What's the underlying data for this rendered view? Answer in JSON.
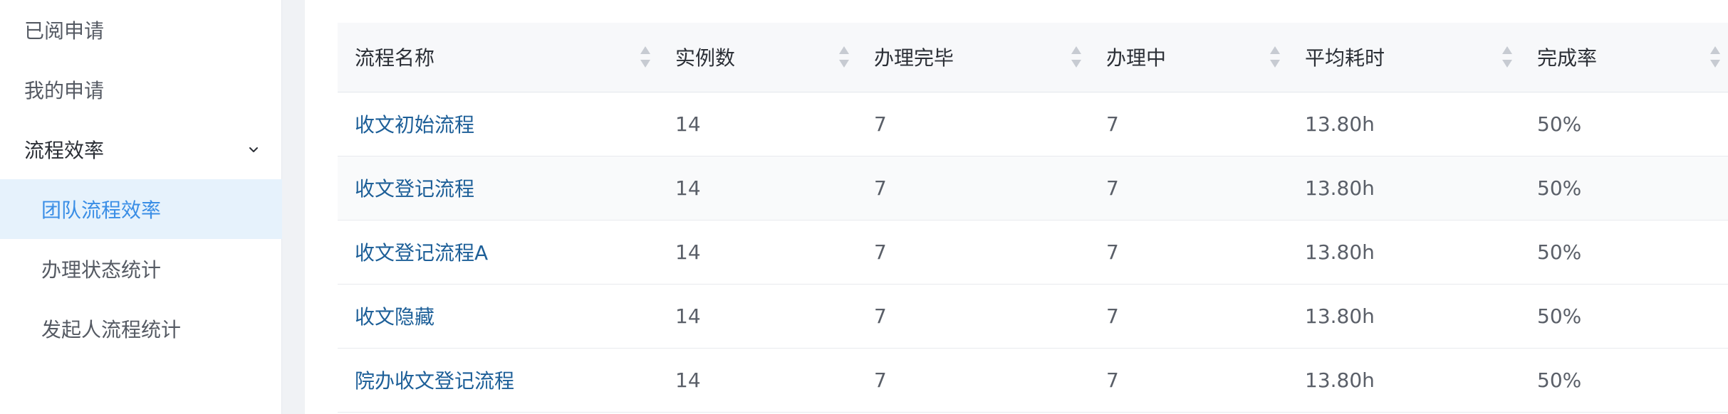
{
  "sidebar": {
    "items": [
      {
        "label": "已阅申请"
      },
      {
        "label": "我的申请"
      },
      {
        "label": "流程效率"
      },
      {
        "label": "团队流程效率"
      },
      {
        "label": "办理状态统计"
      },
      {
        "label": "发起人流程统计"
      }
    ],
    "active_item": "团队流程效率",
    "group_icon": "chevron-down-icon"
  },
  "table": {
    "columns": [
      {
        "label": "流程名称"
      },
      {
        "label": "实例数"
      },
      {
        "label": "办理完毕"
      },
      {
        "label": "办理中"
      },
      {
        "label": "平均耗时"
      },
      {
        "label": "完成率"
      }
    ],
    "rows": [
      [
        "收文初始流程",
        "14",
        "7",
        "7",
        "13.80h",
        "50%"
      ],
      [
        "收文登记流程",
        "14",
        "7",
        "7",
        "13.80h",
        "50%"
      ],
      [
        "收文登记流程A",
        "14",
        "7",
        "7",
        "13.80h",
        "50%"
      ],
      [
        "收文隐藏",
        "14",
        "7",
        "7",
        "13.80h",
        "50%"
      ],
      [
        "院办收文登记流程",
        "14",
        "7",
        "7",
        "13.80h",
        "50%"
      ]
    ]
  },
  "colors": {
    "accent": "#3a8ee6",
    "active_bg": "#e6f2fc",
    "link": "#1d5f98",
    "header_bg": "#f7f8fa"
  }
}
